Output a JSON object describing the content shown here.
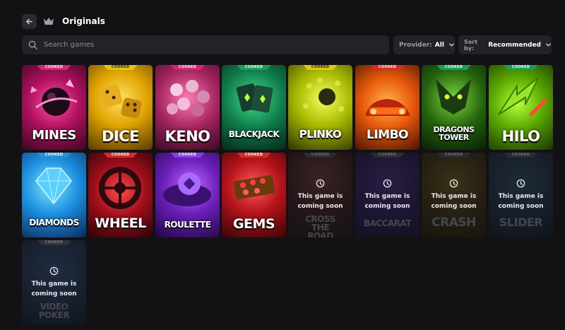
{
  "header": {
    "title": "Originals"
  },
  "search": {
    "placeholder": "Search games"
  },
  "filters": {
    "provider_label": "Provider:",
    "provider_value": "All",
    "sort_label": "Sort by:",
    "sort_value": "Recommended"
  },
  "coming_soon_text": "This game is coming soon",
  "games": [
    {
      "name": "MINES",
      "badge": "COOKED"
    },
    {
      "name": "DICE",
      "badge": "COOKED"
    },
    {
      "name": "KENO",
      "badge": "COOKED"
    },
    {
      "name": "BLACKJACK",
      "badge": "COOKED"
    },
    {
      "name": "PLINKO",
      "badge": "COOKED"
    },
    {
      "name": "LIMBO",
      "badge": "COOKED"
    },
    {
      "name": "DRAGONS TOWER",
      "badge": "COOKED"
    },
    {
      "name": "HILO",
      "badge": "COOKED"
    },
    {
      "name": "DIAMONDS",
      "badge": "COOKED"
    },
    {
      "name": "WHEEL",
      "badge": "COOKED"
    },
    {
      "name": "ROULETTE",
      "badge": "COOKED"
    },
    {
      "name": "GEMS",
      "badge": "COOKED"
    },
    {
      "name": "CROSS THE ROAD",
      "badge": "COOKED"
    },
    {
      "name": "BACCARAT",
      "badge": "COOKED"
    },
    {
      "name": "CRASH",
      "badge": "COOKED"
    },
    {
      "name": "SLIDER",
      "badge": "COOKED"
    },
    {
      "name": "VIDEO POKER",
      "badge": "COOKED"
    }
  ],
  "colors": {
    "background": "#121214",
    "panel": "#222328",
    "badge_pink": "#d4267a",
    "badge_red": "#d92a2a",
    "badge_green": "#18a058",
    "badge_yellow": "#e3c21a",
    "badge_purple": "#8a3cf0"
  },
  "icons": [
    "arrow-left-icon",
    "crown-icon",
    "search-icon",
    "chevron-down-icon",
    "clock-icon"
  ]
}
